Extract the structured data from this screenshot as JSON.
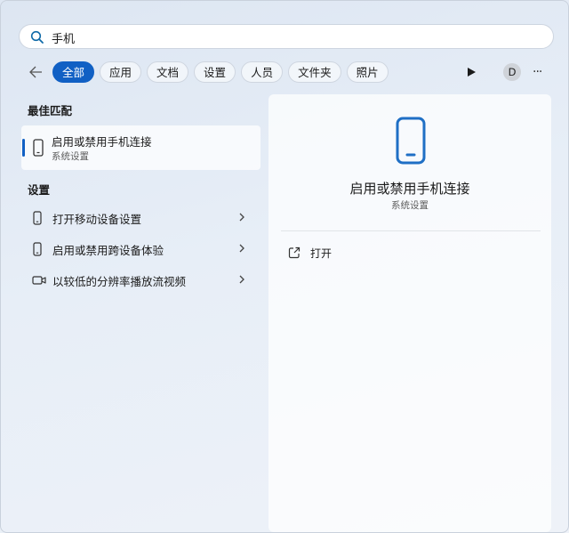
{
  "search": {
    "value": "手机",
    "icon": "search-icon"
  },
  "filters": {
    "back_icon": "arrow-left-icon",
    "chips": [
      "全部",
      "应用",
      "文档",
      "设置",
      "人员",
      "文件夹",
      "照片"
    ],
    "active_index": 0
  },
  "toolbar": {
    "avatar_letter": "D",
    "more_label": "···"
  },
  "best_match": {
    "heading": "最佳匹配",
    "title": "启用或禁用手机连接",
    "subtitle": "系统设置"
  },
  "settings": {
    "heading": "设置",
    "items": [
      {
        "label": "打开移动设备设置",
        "icon": "phone-icon"
      },
      {
        "label": "启用或禁用跨设备体验",
        "icon": "phone-icon"
      },
      {
        "label": "以较低的分辨率播放流视频",
        "icon": "video-camera-icon"
      }
    ]
  },
  "detail": {
    "title": "启用或禁用手机连接",
    "subtitle": "系统设置",
    "actions": [
      {
        "label": "打开",
        "icon": "open-external-icon"
      }
    ]
  },
  "colors": {
    "accent": "#1160c4",
    "phone_icon": "#1f6fc5"
  }
}
